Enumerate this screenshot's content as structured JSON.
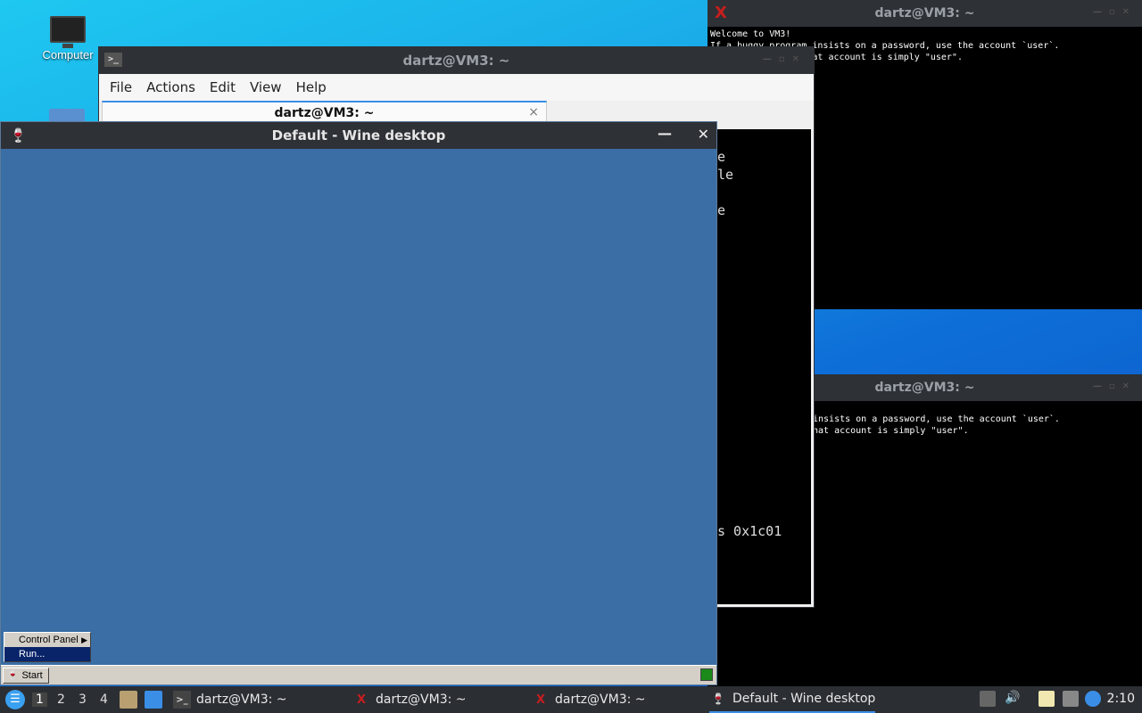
{
  "desktop": {
    "icons": [
      {
        "label": "Computer",
        "icon": "computer-icon"
      }
    ]
  },
  "xterm_top": {
    "title": "dartz@VM3: ~",
    "lines": [
      "Welcome to VM3!",
      "If a buggy program insists on a password, use the account `user`.",
      "The password for that account is simply \"user\"."
    ]
  },
  "xterm_bottom": {
    "title": "dartz@VM3: ~",
    "lines": [
      "insists on a password, use the account `user`.",
      "hat account is simply \"user\"."
    ]
  },
  "lxterminal": {
    "title": "dartz@VM3: ~",
    "menu": [
      "File",
      "Actions",
      "Edit",
      "View",
      "Help"
    ],
    "tab_label": "dartz@VM3: ~",
    "tab_close": "×",
    "fragments": [
      "e",
      "le",
      "e",
      "s 0x1c01"
    ]
  },
  "wine": {
    "title": "Default - Wine desktop",
    "minimize": "—",
    "close": "✕",
    "menu": {
      "items": [
        {
          "label": "Control Panel",
          "submenu": true
        },
        {
          "label": "Run...",
          "selected": true
        }
      ]
    },
    "start_label": "Start"
  },
  "panel": {
    "workspaces": [
      "1",
      "2",
      "3",
      "4"
    ],
    "active_workspace": "1",
    "tasks": [
      {
        "label": "dartz@VM3: ~",
        "icon": "terminal-icon"
      },
      {
        "label": "dartz@VM3: ~",
        "icon": "x-icon"
      },
      {
        "label": "dartz@VM3: ~",
        "icon": "x-icon"
      },
      {
        "label": "Default - Wine desktop",
        "icon": "wine-glass-icon",
        "current": true
      }
    ],
    "clock": "2:10"
  },
  "colors": {
    "titlebar": "#2e3136",
    "wine_desktop": "#3a6ea5",
    "panel": "#2b2e33",
    "accent": "#3a8ee6"
  }
}
